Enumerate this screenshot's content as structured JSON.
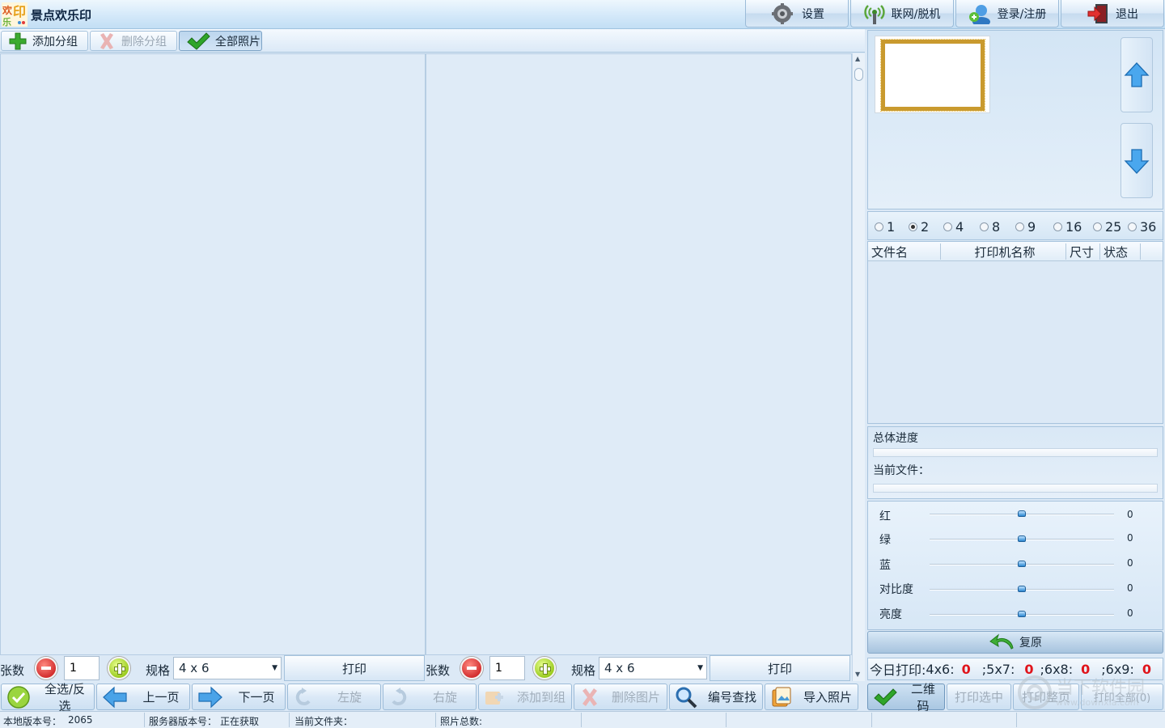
{
  "app": {
    "title": "景点欢乐印"
  },
  "topbar": {
    "settings": "设置",
    "online": "联网/脱机",
    "login": "登录/注册",
    "exit": "退出"
  },
  "groupbar": {
    "add_group": "添加分组",
    "delete_group": "删除分组",
    "all_photos": "全部照片"
  },
  "left_pane": {
    "qty_label": "张数",
    "qty_value": "1",
    "spec_label": "规格",
    "spec_value": "4 x 6",
    "print": "打印"
  },
  "right_pane": {
    "qty_label": "张数",
    "qty_value": "1",
    "spec_label": "规格",
    "spec_value": "4 x 6",
    "print": "打印"
  },
  "toolbar": {
    "select_all": "全选/反选",
    "prev_page": "上一页",
    "next_page": "下一页",
    "rotate_left": "左旋",
    "rotate_right": "右旋",
    "add_to_group": "添加到组",
    "delete_image": "删除图片",
    "find_by_number": "编号查找",
    "import_photos": "导入照片",
    "qrcode": "二维码",
    "print_selected": "打印选中",
    "print_page": "打印整页",
    "print_all": "打印全部(0)"
  },
  "statusbar": {
    "local_version_label": "本地版本号：",
    "local_version": "2065",
    "server_version_label": "服务器版本号：",
    "server_version": "正在获取",
    "current_folder_label": "当前文件夹：",
    "photo_total_label": "照片总数:"
  },
  "layout_options": {
    "values": [
      "1",
      "2",
      "4",
      "8",
      "9",
      "16",
      "25",
      "36"
    ],
    "selected": "2"
  },
  "queue": {
    "columns": [
      "文件名",
      "打印机名称",
      "尺寸",
      "状态"
    ]
  },
  "progress": {
    "overall_label": "总体进度",
    "overall_fraction": 0,
    "current_file_label": "当前文件：",
    "current_fraction": 0
  },
  "adjustments": [
    {
      "label": "红",
      "value": "0"
    },
    {
      "label": "绿",
      "value": "0"
    },
    {
      "label": "蓝",
      "value": "0"
    },
    {
      "label": "对比度",
      "value": "0"
    },
    {
      "label": "亮度",
      "value": "0"
    }
  ],
  "reset": "复原",
  "today": {
    "prefix": "今日打印:",
    "items": [
      {
        "label": "4x6:",
        "count": "0"
      },
      {
        "label": ";5x7:",
        "count": "0"
      },
      {
        "label": ";6x8:",
        "count": "0"
      },
      {
        "label": ";6x9:",
        "count": "0"
      }
    ]
  },
  "watermark": {
    "line1": "当下软件园",
    "line2": "www.downxia.com"
  },
  "colors": {
    "accent": "#2a86d1",
    "count_red": "#e0141b",
    "frame_gold": "#c99a2e"
  }
}
